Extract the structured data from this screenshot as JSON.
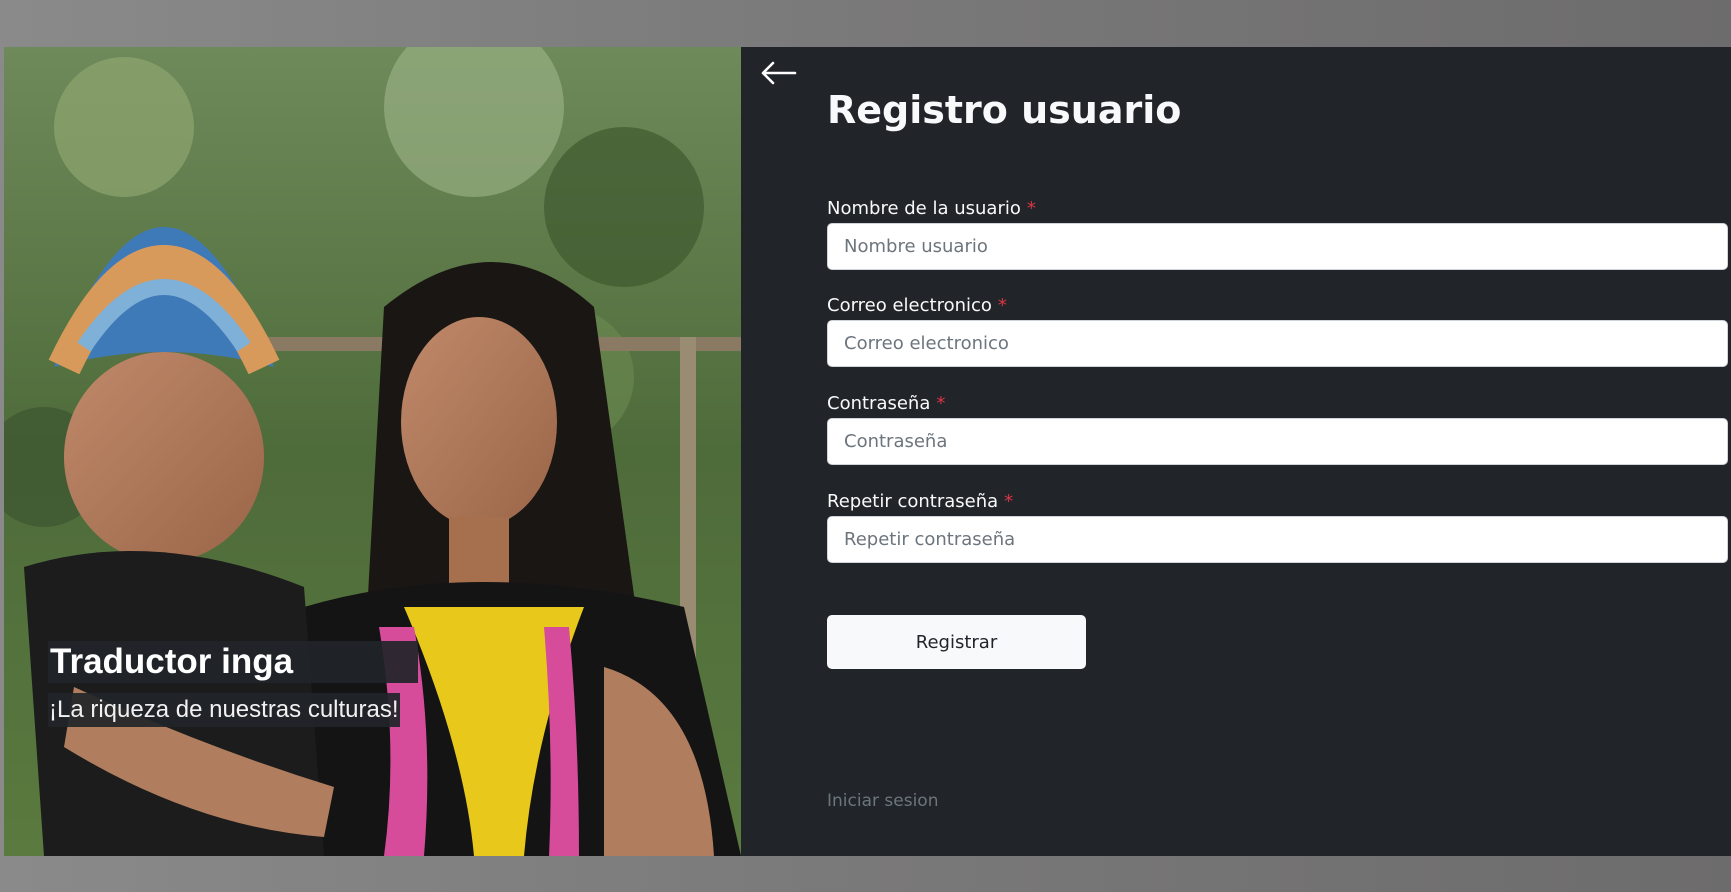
{
  "hero": {
    "title": "Traductor inga",
    "subtitle": "¡La riqueza de nuestras culturas!"
  },
  "form": {
    "back_icon": "arrow-left-icon",
    "title": "Registro usuario",
    "required_mark": "*",
    "fields": [
      {
        "label": "Nombre de la usuario",
        "placeholder": "Nombre usuario",
        "value": ""
      },
      {
        "label": "Correo electronico",
        "placeholder": "Correo electronico",
        "value": ""
      },
      {
        "label": "Contraseña",
        "placeholder": "Contraseña",
        "value": ""
      },
      {
        "label": "Repetir contraseña",
        "placeholder": "Repetir contraseña",
        "value": ""
      }
    ],
    "submit_label": "Registrar",
    "login_link": "Iniciar sesion"
  },
  "colors": {
    "panel_bg": "#212529",
    "required": "#dc3545",
    "button_bg": "#f8f9fa",
    "muted_link": "#6c757d"
  }
}
